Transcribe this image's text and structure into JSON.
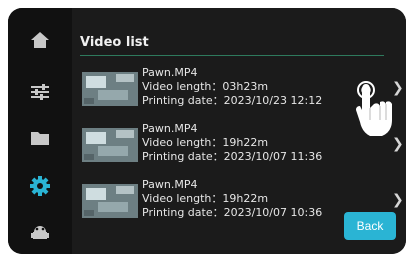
{
  "title": "Video list",
  "videos": [
    {
      "name": "Pawn.MP4",
      "length": "Video length：03h23m",
      "date": "Printing date：2023/10/23 12:12"
    },
    {
      "name": "Pawn.MP4",
      "length": "Video length：19h22m",
      "date": "Printing date：2023/10/07 11:36"
    },
    {
      "name": "Pawn.MP4",
      "length": "Video length：19h22m",
      "date": "Printing date：2023/10/07 10:36"
    }
  ],
  "back_label": "Back",
  "icons": {
    "nav": [
      "home-icon",
      "sliders-icon",
      "folder-icon",
      "gear-icon",
      "robot-icon"
    ],
    "row_chevron": "chevron-right-icon",
    "pointer": "hand-pointer-icon"
  },
  "colors": {
    "accent": "#2ab4d4",
    "title_line": "#2e7a5d",
    "active_nav": "#2ab4d4"
  }
}
